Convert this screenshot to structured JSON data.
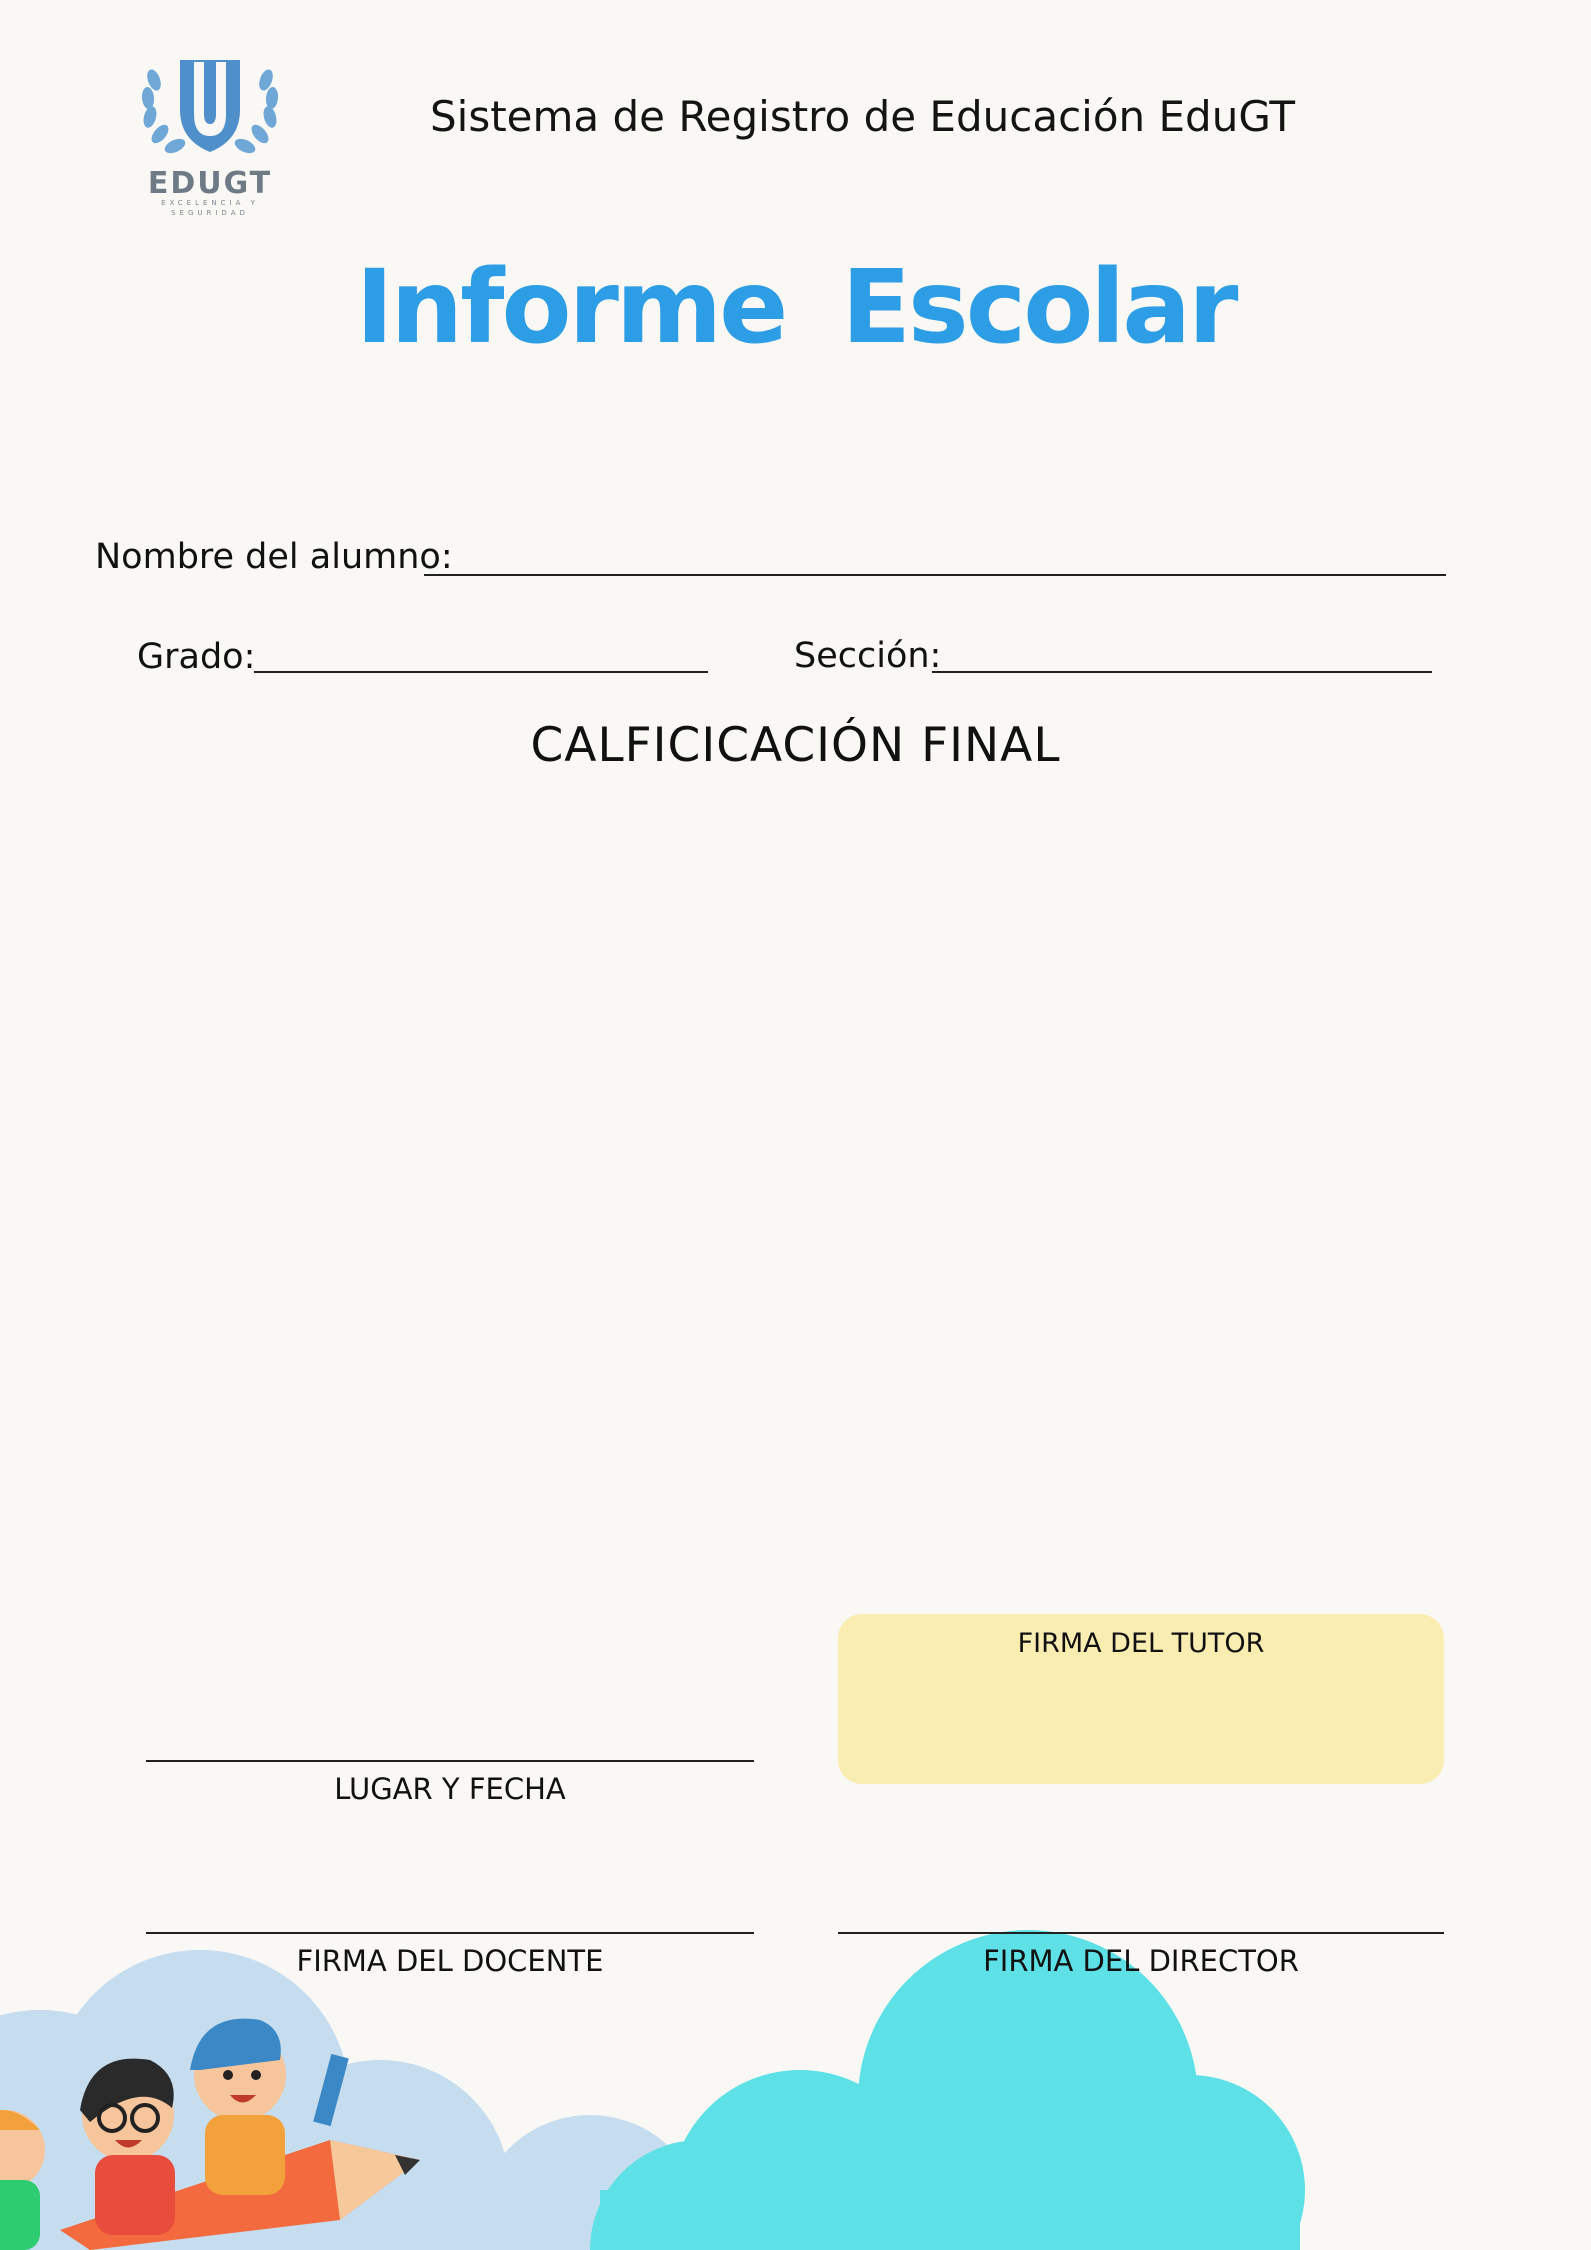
{
  "logo": {
    "name": "EDUGT",
    "tagline": "EXCELENCIA Y SEGURIDAD"
  },
  "header": {
    "system_name": "Sistema de Registro de Educación  EduGT"
  },
  "report": {
    "title_word1": "Informe",
    "title_word2": "Escolar"
  },
  "form": {
    "student_label": "Nombre del alumno:",
    "grade_label": "Grado:",
    "section_label": "Sección:",
    "final_grade_heading": "CALFICICACIÓN FINAL"
  },
  "signatures": {
    "tutor": "FIRMA DEL TUTOR",
    "place_date": "LUGAR Y FECHA",
    "teacher": "FIRMA DEL DOCENTE",
    "director": "FIRMA DEL DIRECTOR"
  },
  "colors": {
    "title": "#2d9ee6",
    "tutor_box": "#faedb2",
    "cloud_light": "#c6ddef",
    "cloud_cyan": "#5ee1e6"
  }
}
